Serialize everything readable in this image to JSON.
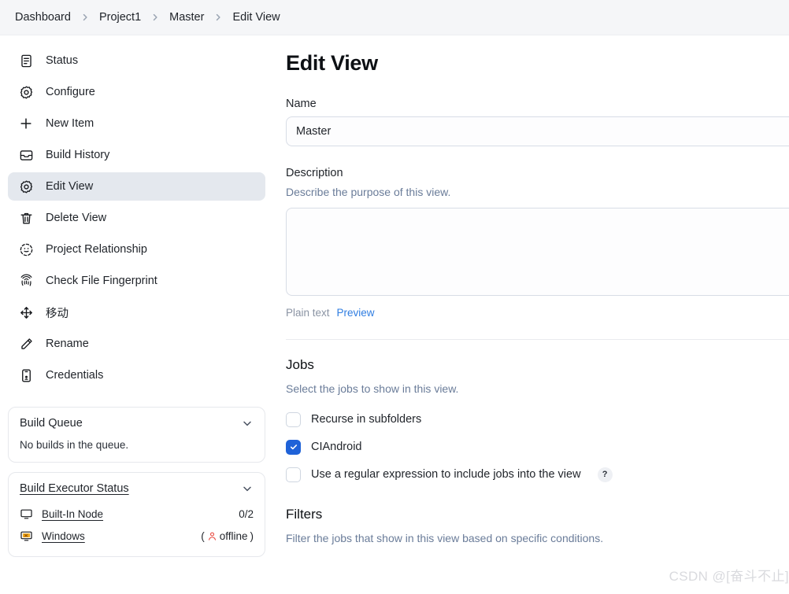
{
  "breadcrumb": {
    "items": [
      {
        "label": "Dashboard"
      },
      {
        "label": "Project1"
      },
      {
        "label": "Master"
      },
      {
        "label": "Edit View"
      }
    ],
    "separator_icon": "chevron-right-icon"
  },
  "sidebar": {
    "items": [
      {
        "label": "Status",
        "icon": "document-icon",
        "active": false
      },
      {
        "label": "Configure",
        "icon": "gear-icon",
        "active": false
      },
      {
        "label": "New Item",
        "icon": "plus-icon",
        "active": false
      },
      {
        "label": "Build History",
        "icon": "archive-icon",
        "active": false
      },
      {
        "label": "Edit View",
        "icon": "gear-icon",
        "active": true
      },
      {
        "label": "Delete View",
        "icon": "trash-icon",
        "active": false
      },
      {
        "label": "Project Relationship",
        "icon": "dashed-circle-icon",
        "active": false
      },
      {
        "label": "Check File Fingerprint",
        "icon": "fingerprint-icon",
        "active": false
      },
      {
        "label": "移动",
        "icon": "move-arrows-icon",
        "active": false
      },
      {
        "label": "Rename",
        "icon": "pencil-icon",
        "active": false
      },
      {
        "label": "Credentials",
        "icon": "id-card-icon",
        "active": false
      }
    ],
    "build_queue": {
      "title": "Build Queue",
      "collapse_icon": "chevron-down-icon",
      "empty_message": "No builds in the queue."
    },
    "build_executor_status": {
      "title": "Build Executor Status",
      "collapse_icon": "chevron-down-icon",
      "executors": [
        {
          "name": "Built-In Node",
          "icon": "computer-icon",
          "value": "0/2",
          "offline": false
        },
        {
          "name": "Windows",
          "icon": "computer-error-icon",
          "value": "offline",
          "offline": true,
          "value_prefix": "(",
          "value_suffix": ")",
          "offline_icon": "person-icon"
        }
      ]
    }
  },
  "main": {
    "title": "Edit View",
    "name_field": {
      "label": "Name",
      "value": "Master",
      "placeholder": ""
    },
    "description_field": {
      "label": "Description",
      "hint": "Describe the purpose of this view.",
      "value": "",
      "placeholder": "",
      "plain_text_label": "Plain text",
      "preview_link": "Preview"
    },
    "jobs_section": {
      "title": "Jobs",
      "hint": "Select the jobs to show in this view.",
      "checkboxes": [
        {
          "label": "Recurse in subfolders",
          "checked": false,
          "help": false
        },
        {
          "label": "CIAndroid",
          "checked": true,
          "help": false
        },
        {
          "label": "Use a regular expression to include jobs into the view",
          "checked": false,
          "help": true,
          "help_label": "?"
        }
      ]
    },
    "filters_section": {
      "title": "Filters",
      "hint": "Filter the jobs that show in this view based on specific conditions."
    }
  },
  "watermark": {
    "text": "CSDN @[奋斗不止]"
  },
  "colors": {
    "accent_blue": "#1f62d8",
    "link_blue": "#2f7de1",
    "hint_blue": "#6a7c99",
    "active_item_bg": "#e4e8ee",
    "header_bg": "#f5f6f8",
    "offline_red": "#e8443a",
    "watermark_gray": "#d9dade"
  }
}
